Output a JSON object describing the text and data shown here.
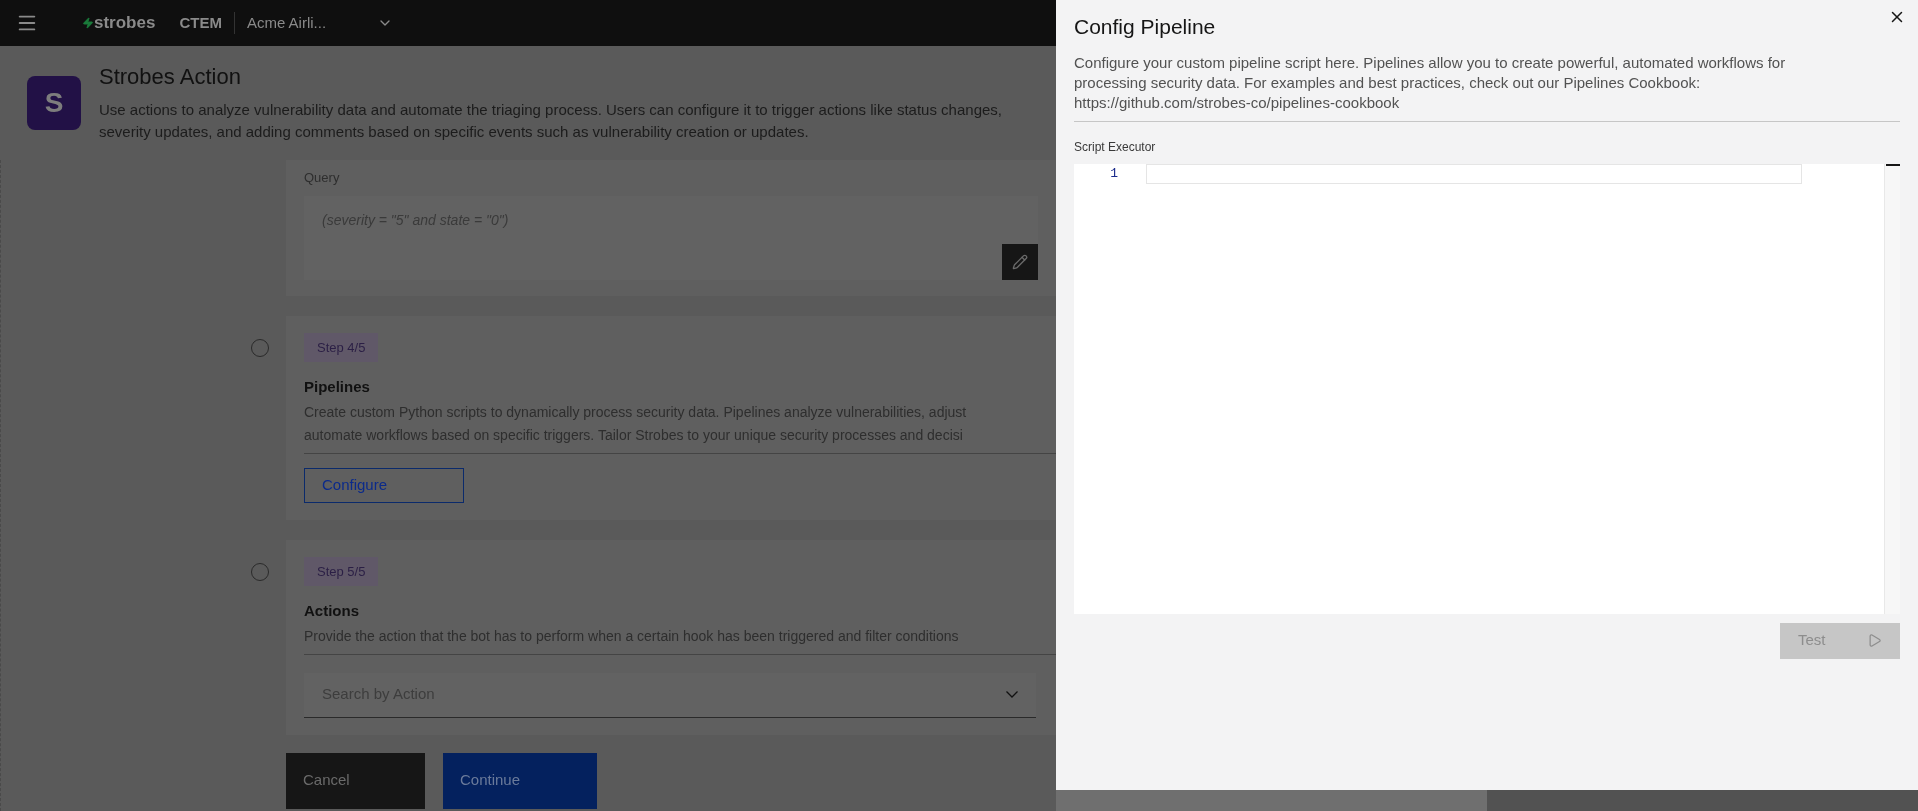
{
  "topbar": {
    "brand": "strobes",
    "product": "CTEM",
    "account": "Acme Airli..."
  },
  "page_header": {
    "logo_letter": "S",
    "title": "Strobes Action",
    "description": "Use actions to analyze vulnerability data and automate the triaging process. Users can configure it to trigger actions like status changes, severity updates, and adding comments based on specific events such as vulnerability creation or updates."
  },
  "query": {
    "label": "Query",
    "value": "(severity = \"5\" and state = \"0\")"
  },
  "steps": [
    {
      "kind": "configure",
      "badge": "Step 4/5",
      "title": "Pipelines",
      "description_lines": [
        "Create custom Python scripts to dynamically process security data. Pipelines analyze vulnerabilities, adjust",
        "automate workflows based on specific triggers. Tailor Strobes to your unique security processes and decisi"
      ],
      "button": "Configure"
    },
    {
      "kind": "select",
      "badge": "Step 5/5",
      "title": "Actions",
      "description_lines": [
        "Provide the action that the bot has to perform when a certain hook has been triggered and filter conditions"
      ],
      "placeholder": "Search by Action"
    }
  ],
  "footer_buttons": [
    {
      "label": "Cancel",
      "kind": "secondary"
    },
    {
      "label": "Continue",
      "kind": "primary"
    }
  ],
  "panel": {
    "title": "Config Pipeline",
    "description": "Configure your custom pipeline script here. Pipelines allow you to create powerful, automated workflows for processing security data. For examples and best practices, check out our Pipelines Cookbook: https://github.com/strobes-co/pipelines-cookbook",
    "editor_label": "Script Executor",
    "line_numbers": [
      "1"
    ],
    "test_button": {
      "label": "Test",
      "disabled": true
    }
  }
}
